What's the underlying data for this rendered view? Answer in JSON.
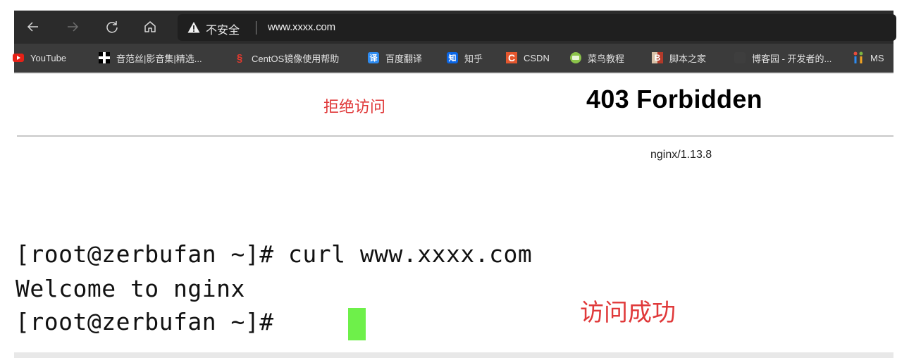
{
  "browser": {
    "nav": {
      "back_icon": "arrow-left",
      "forward_icon": "arrow-right",
      "reload_icon": "reload",
      "home_icon": "home"
    },
    "address_bar": {
      "security_icon": "warning-triangle",
      "security_label": "不安全",
      "url": "www.xxxx.com"
    },
    "bookmarks": [
      {
        "label": "YouTube",
        "icon": "youtube-icon",
        "color": "#e62117"
      },
      {
        "label": "音范丝|影音集|精选...",
        "icon": "cross-icon",
        "color": "#ffffff"
      },
      {
        "label": "CentOS镜像使用帮助",
        "icon": "mirror-icon",
        "color": "#e53a2f"
      },
      {
        "label": "百度翻译",
        "icon": "translate-icon",
        "glyph": "译",
        "color": "#2e8bf0"
      },
      {
        "label": "知乎",
        "icon": "zhihu-icon",
        "glyph": "知",
        "color": "#0a66e6"
      },
      {
        "label": "CSDN",
        "icon": "csdn-icon",
        "glyph": "C",
        "color": "#e4572e"
      },
      {
        "label": "菜鸟教程",
        "icon": "runoob-icon",
        "color": "#8bc34a"
      },
      {
        "label": "脚本之家",
        "icon": "jb51-icon",
        "color": "#c0392b"
      },
      {
        "label": "博客园 - 开发者的...",
        "icon": "cnblogs-icon",
        "color": "#3b3b3b"
      },
      {
        "label": "MS",
        "icon": "ms-icon",
        "color": "#f5a623"
      }
    ]
  },
  "page": {
    "annotation_refused": "拒绝访问",
    "title": "403 Forbidden",
    "server": "nginx/1.13.8"
  },
  "terminal": {
    "lines": [
      "[root@zerbufan ~]# curl www.xxxx.com",
      "Welcome to nginx",
      "[root@zerbufan ~]# "
    ],
    "cursor_color": "#6ef04a",
    "annotation_success": "访问成功"
  },
  "colors": {
    "annotation_red": "#e0393a",
    "toolbar_bg": "#2b2b2b",
    "bookmark_bg": "#3b3b3b"
  }
}
